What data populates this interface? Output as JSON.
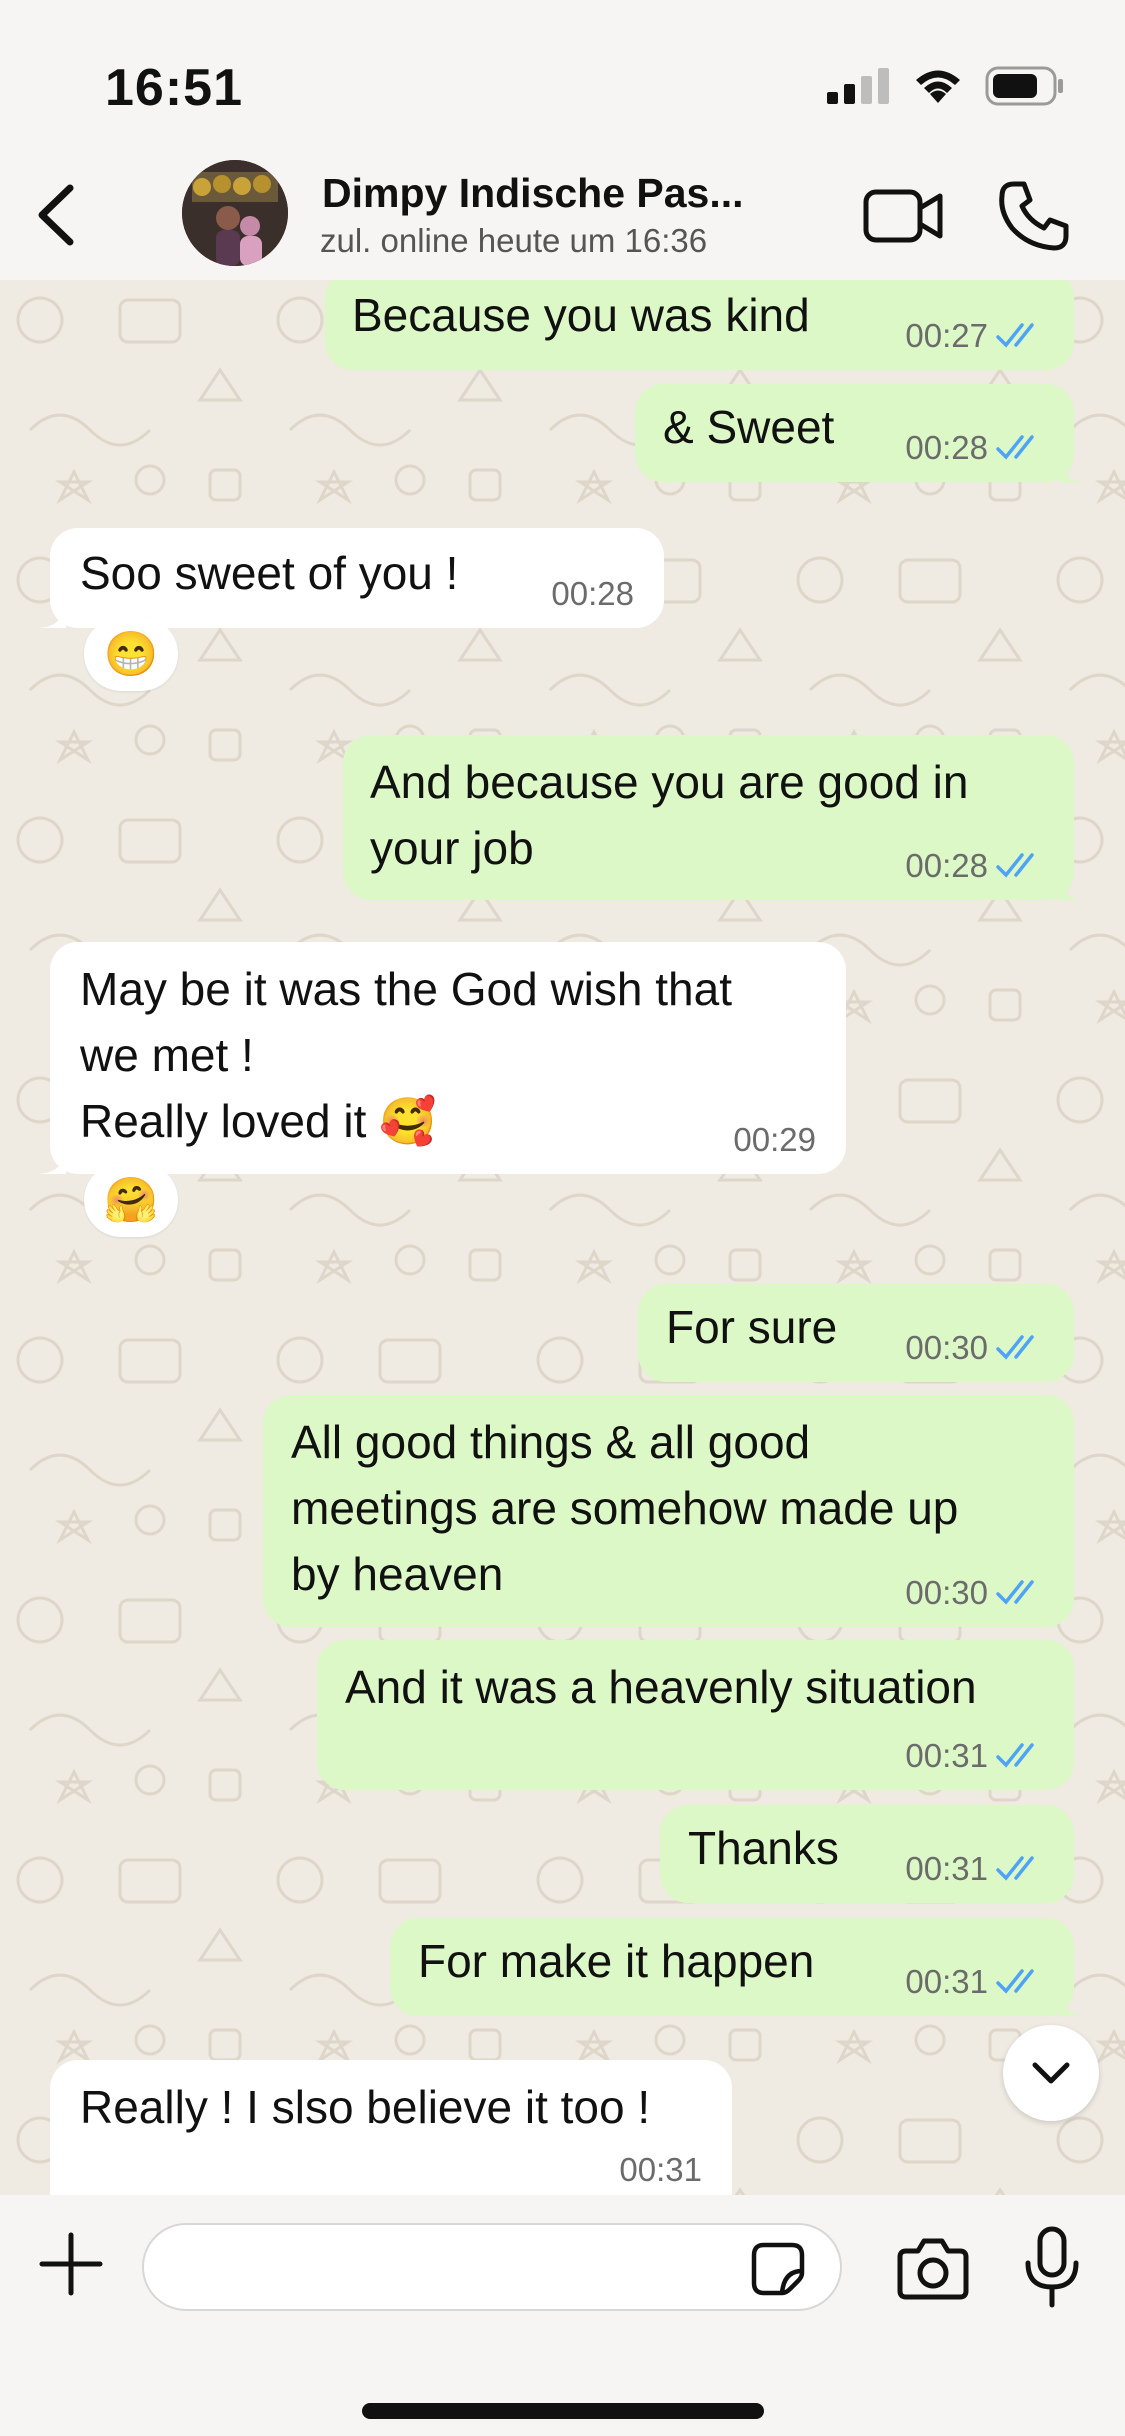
{
  "status_bar": {
    "time": "16:51",
    "icons": [
      "signal-icon",
      "wifi-icon",
      "battery-icon"
    ]
  },
  "header": {
    "contact_name": "Dimpy Indische Pas...",
    "contact_status": "zul. online heute um 16:36",
    "icons": [
      "back-icon",
      "video-camera-icon",
      "phone-icon"
    ]
  },
  "messages": [
    {
      "direction": "out",
      "text": "Because you was kind",
      "time": "00:27",
      "read": true
    },
    {
      "direction": "out",
      "text": "& Sweet",
      "time": "00:28",
      "read": true
    },
    {
      "direction": "in",
      "text": "Soo sweet of you !",
      "time": "00:28",
      "reaction": "😁"
    },
    {
      "direction": "out",
      "text": "And because you are good in\nyour job",
      "time": "00:28",
      "read": true
    },
    {
      "direction": "in",
      "text": "May be it was the God wish that\nwe met !\nReally loved it 🥰",
      "time": "00:29",
      "reaction": "🤗"
    },
    {
      "direction": "out",
      "text": "For sure",
      "time": "00:30",
      "read": true
    },
    {
      "direction": "out",
      "text": "All good things & all good\nmeetings are somehow made up\nby heaven",
      "time": "00:30",
      "read": true
    },
    {
      "direction": "out",
      "text": "And it was a heavenly situation",
      "time": "00:31",
      "read": true
    },
    {
      "direction": "out",
      "text": "Thanks",
      "time": "00:31",
      "read": true
    },
    {
      "direction": "out",
      "text": "For make it happen",
      "time": "00:31",
      "read": true
    },
    {
      "direction": "in",
      "text": "Really ! I slso believe it too !",
      "time": "00:31"
    }
  ],
  "input_bar": {
    "message_value": "",
    "icons": [
      "plus-icon",
      "sticker-icon",
      "camera-icon",
      "microphone-icon"
    ]
  },
  "colors": {
    "outgoing_bubble": "#dcf8c6",
    "incoming_bubble": "#ffffff",
    "read_ticks": "#4fa3f7",
    "chat_background": "#efeae2"
  }
}
